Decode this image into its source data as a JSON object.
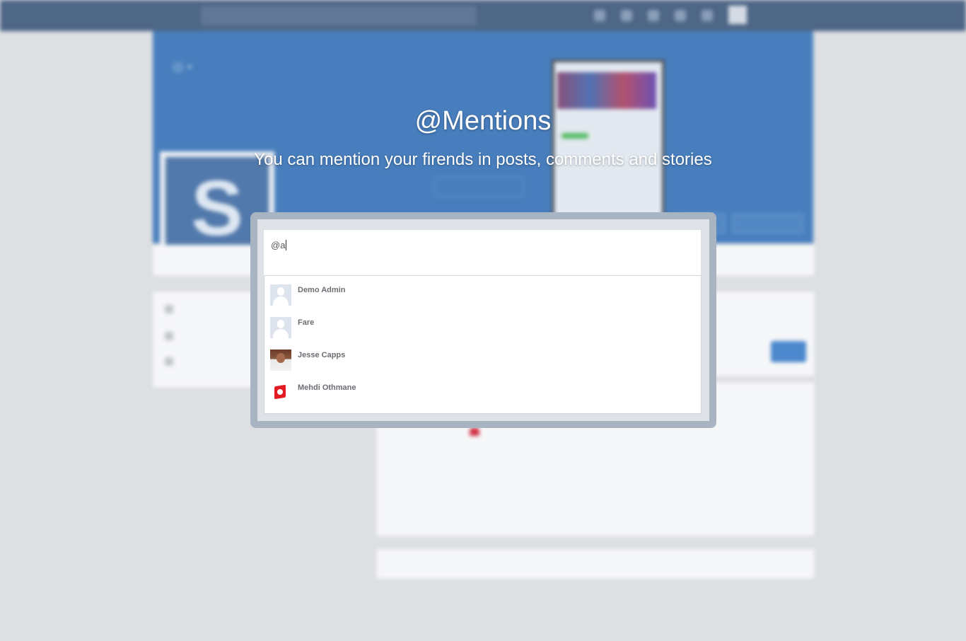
{
  "overlay": {
    "heading": "@Mentions",
    "subheading": "You can mention your firends in posts, comments and stories"
  },
  "composer": {
    "value": "@a"
  },
  "suggestions": [
    {
      "name": "Demo Admin",
      "avatar": "default-avatar-icon"
    },
    {
      "name": "Fare",
      "avatar": "default-avatar-icon"
    },
    {
      "name": "Jesse Capps",
      "avatar": "photo"
    },
    {
      "name": "Mehdi Othmane",
      "avatar": "tunisia-flag-icon"
    }
  ],
  "colors": {
    "topbar": "#365276",
    "cover": "#2f6db4",
    "accent": "#3478c6",
    "frame": "#a9b4c2"
  }
}
